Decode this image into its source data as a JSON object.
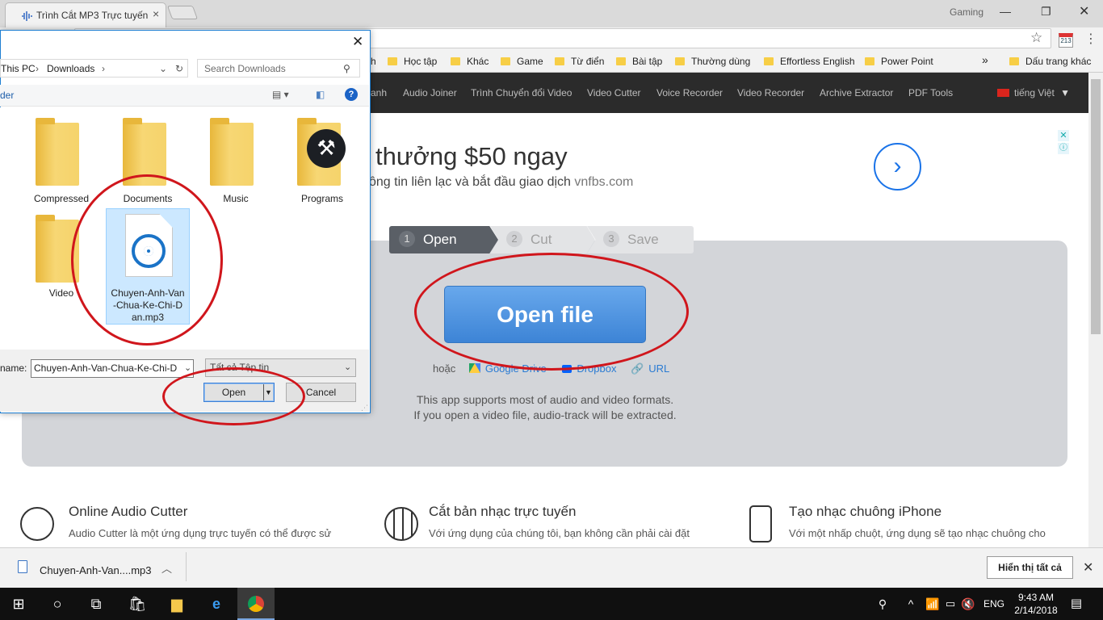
{
  "browser": {
    "tab_title": "Trình Cắt MP3 Trực tuyến",
    "profile": "Gaming",
    "bookmarks": [
      "Học tập",
      "Khác",
      "Game",
      "Từ điển",
      "Bài tập",
      "Thường dùng",
      "Effortless English",
      "Power Point"
    ],
    "bookmark_overflow": "»",
    "other_bookmarks": "Dấu trang khác",
    "bookmark_partial": "h",
    "calendar_badge": "213"
  },
  "site_nav": {
    "items": [
      "anh",
      "Audio Joiner",
      "Trình Chuyển đổi Video",
      "Video Cutter",
      "Voice Recorder",
      "Video Recorder",
      "Archive Extractor",
      "PDF Tools"
    ],
    "language": "tiếng Việt"
  },
  "ad": {
    "title": "thưởng $50 ngay",
    "subtitle": "ông tin liên lạc và bắt đầu giao dịch",
    "domain": "vnfbs.com"
  },
  "cutter": {
    "steps": [
      {
        "num": "1",
        "label": "Open"
      },
      {
        "num": "2",
        "label": "Cut"
      },
      {
        "num": "3",
        "label": "Save"
      }
    ],
    "open_button": "Open file",
    "alt_prefix": "hoặc",
    "alt_links": [
      "Google Drive",
      "Dropbox",
      "URL"
    ],
    "support_line1": "This app supports most of audio and video formats.",
    "support_line2": "If you open a video file, audio-track will be extracted."
  },
  "features": [
    {
      "title": "Online Audio Cutter",
      "text": "Audio Cutter là một ứng dụng trực tuyến có thể được sử"
    },
    {
      "title": "Cắt bản nhạc trực tuyến",
      "text": "Với ứng dụng của chúng tôi, bạn không cần phải cài đặt"
    },
    {
      "title": "Tạo nhạc chuông iPhone",
      "text": "Với một nhấp chuột, ứng dụng sẽ tạo nhạc chuông cho"
    }
  ],
  "downloads": {
    "file": "Chuyen-Anh-Van....mp3",
    "show_all": "Hiển thị tất cả"
  },
  "taskbar": {
    "lang": "ENG",
    "time": "9:43 AM",
    "date": "2/14/2018"
  },
  "dialog": {
    "path": [
      "This PC",
      "Downloads"
    ],
    "search_placeholder": "Search Downloads",
    "toolbar_label": "der",
    "folders": [
      "Compressed",
      "Documents",
      "Music",
      "Programs",
      "Video"
    ],
    "selected_file": "Chuyen-Anh-Van-Chua-Ke-Chi-Dan.mp3",
    "selected_file_lines": [
      "Chuyen-Anh-Van",
      "-Chua-Ke-Chi-D",
      "an.mp3"
    ],
    "filename_label": "name:",
    "filename_value": "Chuyen-Anh-Van-Chua-Ke-Chi-D",
    "filetype_value": "Tất cả Tệp tin",
    "open_label": "Open",
    "cancel_label": "Cancel"
  },
  "colors": {
    "annotation_red": "#d0161c",
    "open_button_blue": "#4a90e2",
    "nav_bg": "#2b2b2b",
    "dialog_border": "#1e7fd2"
  }
}
